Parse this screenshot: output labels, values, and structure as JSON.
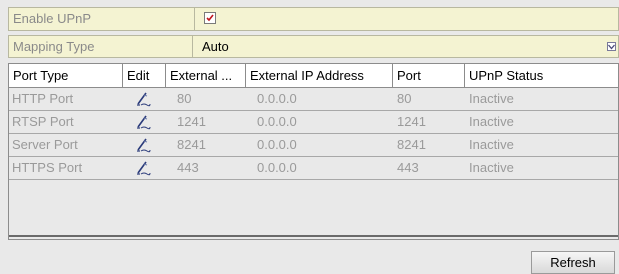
{
  "form": {
    "enable_upnp": {
      "label": "Enable UPnP",
      "checked": true
    },
    "mapping_type": {
      "label": "Mapping Type",
      "value": "Auto"
    }
  },
  "table": {
    "headers": {
      "port_type": "Port Type",
      "edit": "Edit",
      "external": "External ...",
      "external_ip": "External IP Address",
      "port": "Port",
      "upnp_status": "UPnP Status"
    },
    "rows": [
      {
        "port_type": "HTTP Port",
        "external": "80",
        "external_ip": "0.0.0.0",
        "port": "80",
        "status": "Inactive"
      },
      {
        "port_type": "RTSP Port",
        "external": "1241",
        "external_ip": "0.0.0.0",
        "port": "1241",
        "status": "Inactive"
      },
      {
        "port_type": "Server Port",
        "external": "8241",
        "external_ip": "0.0.0.0",
        "port": "8241",
        "status": "Inactive"
      },
      {
        "port_type": "HTTPS Port",
        "external": "443",
        "external_ip": "0.0.0.0",
        "port": "443",
        "status": "Inactive"
      }
    ]
  },
  "buttons": {
    "refresh": "Refresh"
  },
  "icons": {
    "checkbox_check": "check-icon",
    "dropdown": "chevron-down-icon",
    "edit": "pencil-icon"
  },
  "colors": {
    "form_row_bg": "#f4f3d2",
    "check_mark": "#c0141c",
    "muted_text": "#9a9a9a"
  }
}
